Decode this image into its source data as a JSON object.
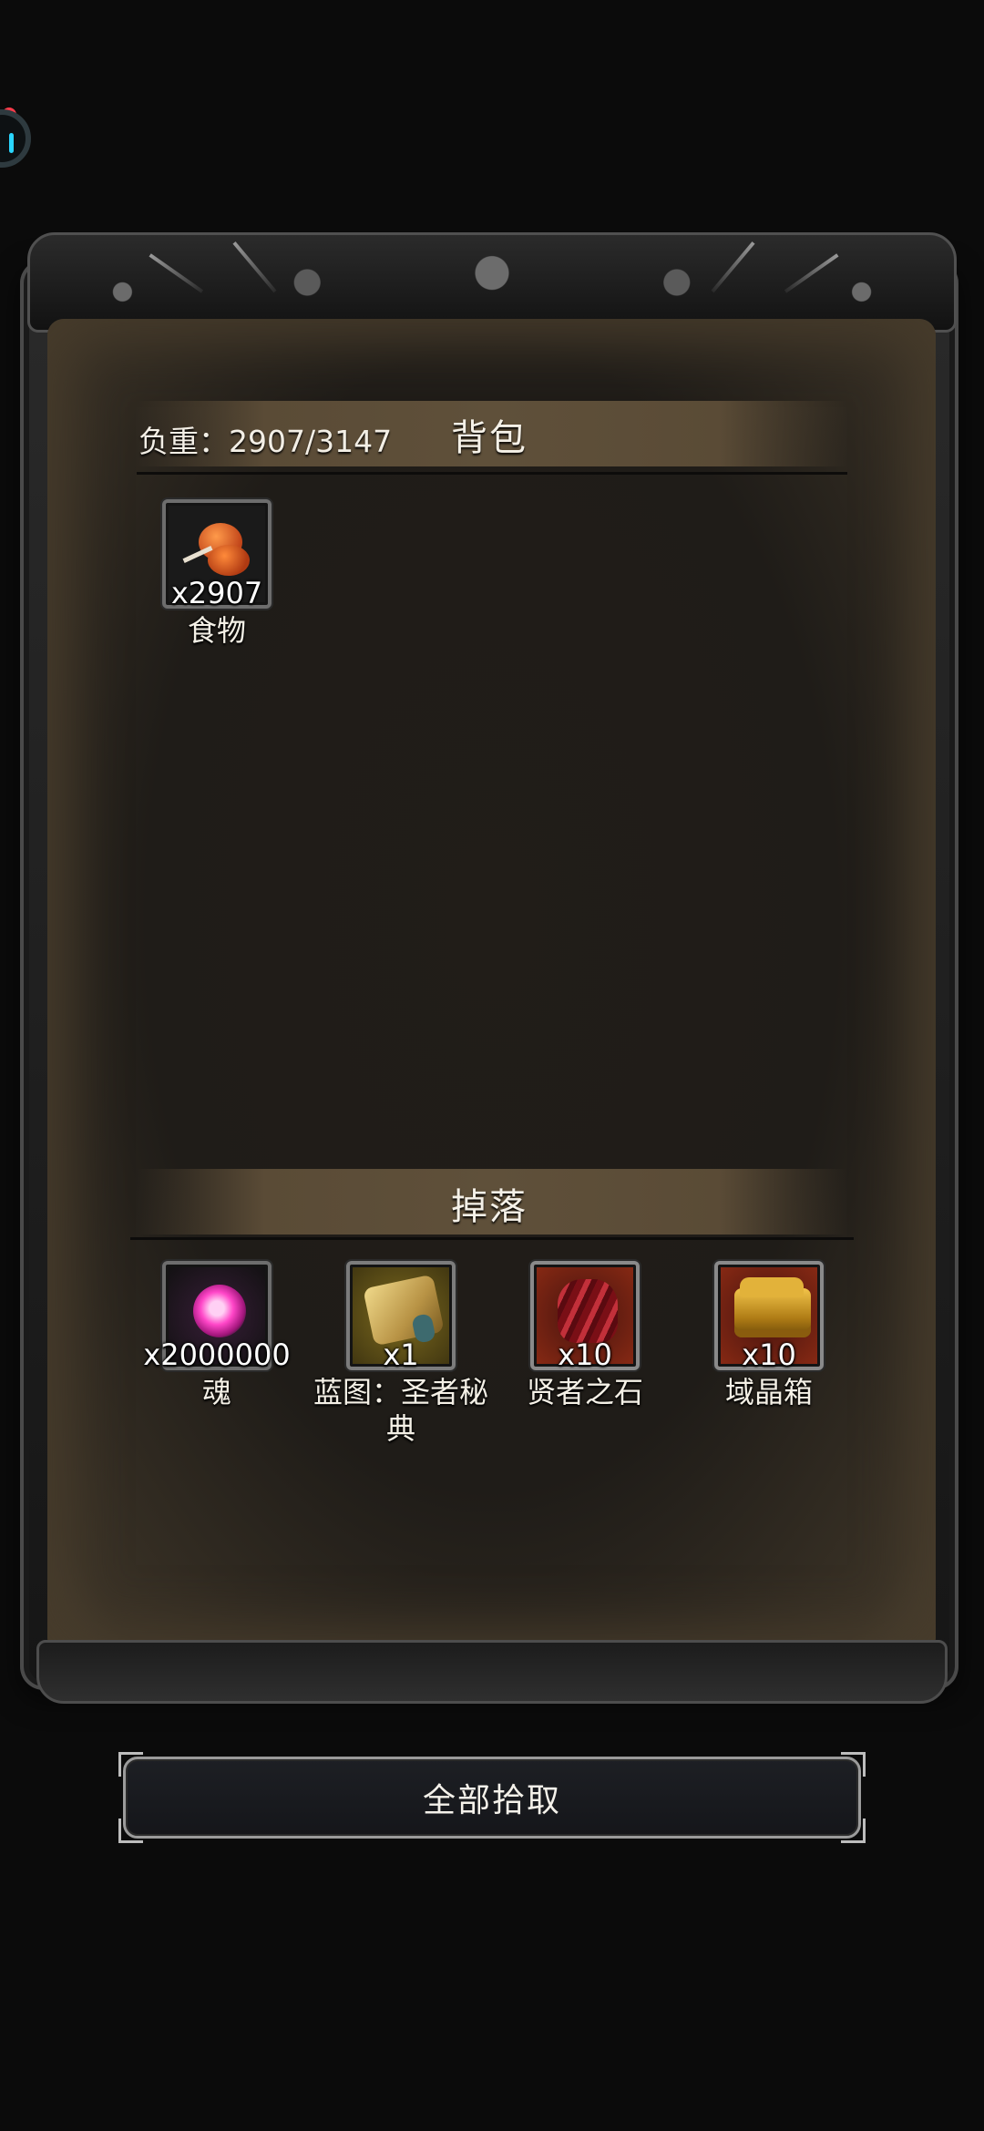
{
  "inventory": {
    "weight_text": "负重：2907/3147",
    "title": "背包",
    "items": [
      {
        "quantity": "x2907",
        "name": "食物",
        "icon": "meat-icon"
      }
    ]
  },
  "loot": {
    "title": "掉落",
    "items": [
      {
        "quantity": "x2000000",
        "name": "魂",
        "icon": "soul-orb-icon"
      },
      {
        "quantity": "x1",
        "name": "蓝图：圣者秘典",
        "icon": "scroll-icon"
      },
      {
        "quantity": "x10",
        "name": "贤者之石",
        "icon": "sage-stone-icon"
      },
      {
        "quantity": "x10",
        "name": "域晶箱",
        "icon": "treasure-chest-icon"
      }
    ]
  },
  "actions": {
    "pickup_all_label": "全部拾取"
  },
  "colors": {
    "panel_bg": "#1f1c18",
    "section_bar": "#5f503a",
    "button_bg": "#1d1f24"
  }
}
